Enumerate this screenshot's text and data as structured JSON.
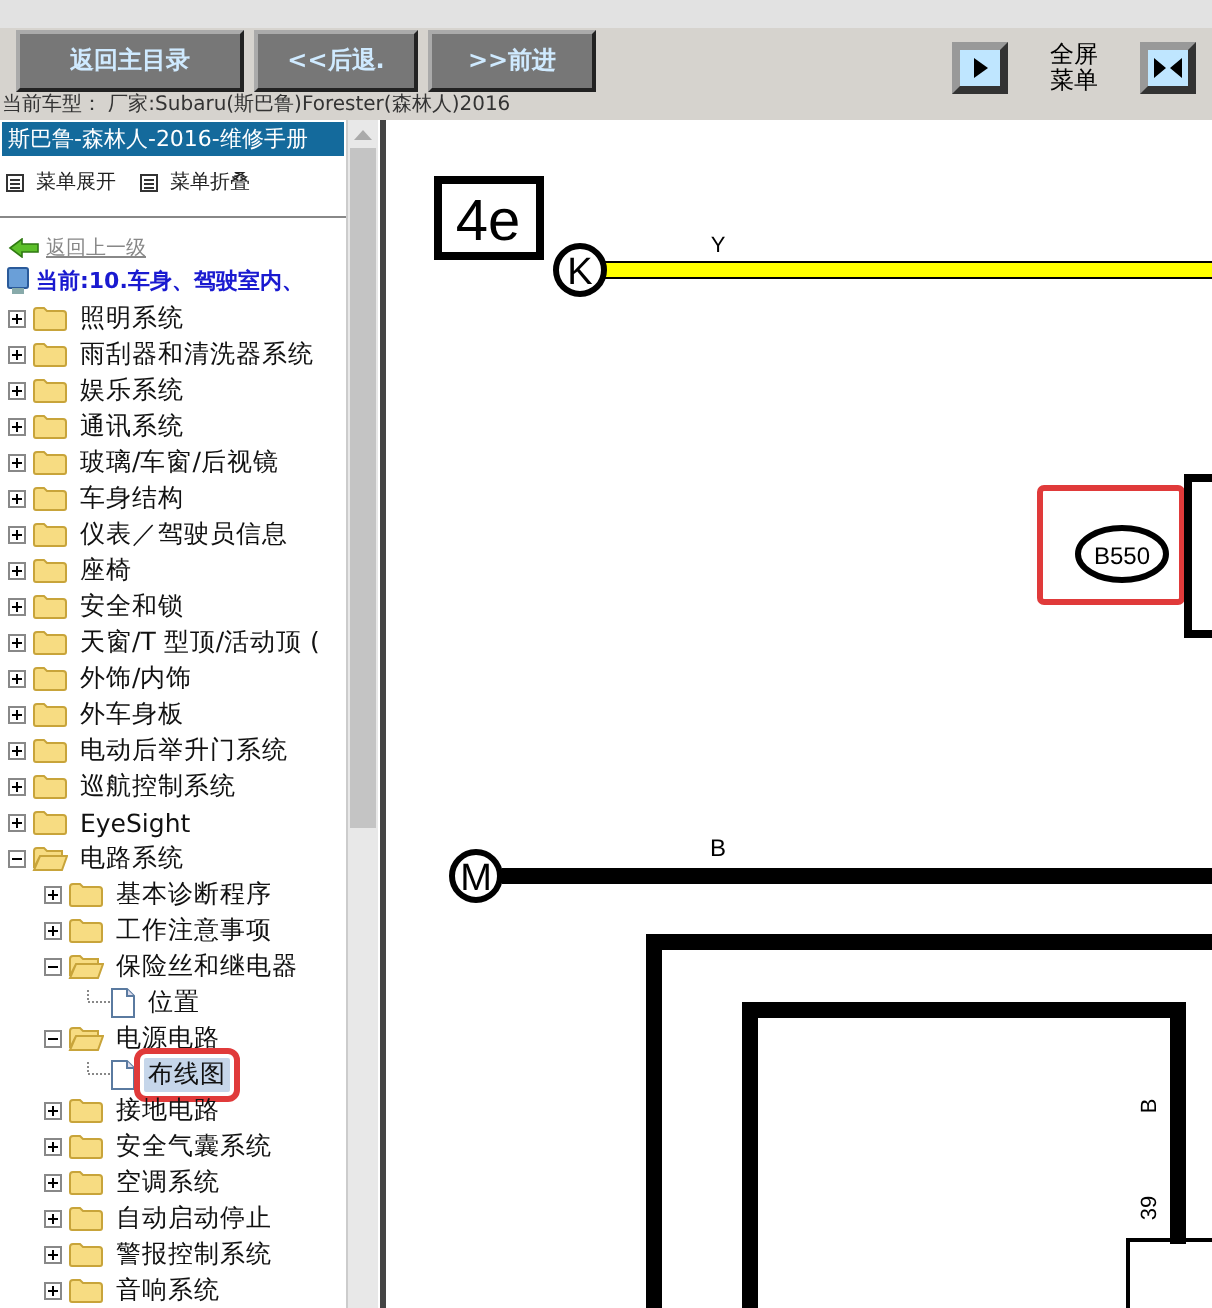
{
  "toolbar": {
    "buttons": [
      "返回主目录",
      "<<后退.",
      ">>前进"
    ],
    "fullscreen_label": "全屏菜单"
  },
  "vehicle_info": "当前车型：  厂家:Subaru(斯巴鲁)Forester(森林人)2016",
  "sidebar": {
    "title": "斯巴鲁-森林人-2016-维修手册",
    "expand_all": "菜单展开",
    "collapse_all": "菜单折叠",
    "back_link": "返回上一级",
    "current": "当前:10.车身、驾驶室内、",
    "tree": [
      {
        "label": "照明系统",
        "kind": "folder",
        "expanded": false,
        "selected": false
      },
      {
        "label": "雨刮器和清洗器系统",
        "kind": "folder",
        "expanded": false,
        "selected": false
      },
      {
        "label": "娱乐系统",
        "kind": "folder",
        "expanded": false,
        "selected": false
      },
      {
        "label": "通讯系统",
        "kind": "folder",
        "expanded": false,
        "selected": false
      },
      {
        "label": "玻璃/车窗/后视镜",
        "kind": "folder",
        "expanded": false,
        "selected": false
      },
      {
        "label": "车身结构",
        "kind": "folder",
        "expanded": false,
        "selected": false
      },
      {
        "label": "仪表／驾驶员信息",
        "kind": "folder",
        "expanded": false,
        "selected": false
      },
      {
        "label": "座椅",
        "kind": "folder",
        "expanded": false,
        "selected": false
      },
      {
        "label": "安全和锁",
        "kind": "folder",
        "expanded": false,
        "selected": false
      },
      {
        "label": "天窗/T 型顶/活动顶 (",
        "kind": "folder",
        "expanded": false,
        "selected": false
      },
      {
        "label": "外饰/内饰",
        "kind": "folder",
        "expanded": false,
        "selected": false
      },
      {
        "label": "外车身板",
        "kind": "folder",
        "expanded": false,
        "selected": false
      },
      {
        "label": "电动后举升门系统",
        "kind": "folder",
        "expanded": false,
        "selected": false
      },
      {
        "label": "巡航控制系统",
        "kind": "folder",
        "expanded": false,
        "selected": false
      },
      {
        "label": "EyeSight",
        "kind": "folder",
        "expanded": false,
        "selected": false
      },
      {
        "label": "电路系统",
        "kind": "folder",
        "expanded": true,
        "selected": false,
        "children": [
          {
            "label": "基本诊断程序",
            "kind": "folder",
            "expanded": false,
            "selected": false
          },
          {
            "label": "工作注意事项",
            "kind": "folder",
            "expanded": false,
            "selected": false
          },
          {
            "label": "保险丝和继电器",
            "kind": "folder",
            "expanded": true,
            "selected": false,
            "children": [
              {
                "label": "位置",
                "kind": "page",
                "selected": false
              }
            ]
          },
          {
            "label": "电源电路",
            "kind": "folder",
            "expanded": true,
            "selected": false,
            "children": [
              {
                "label": "布线图",
                "kind": "page",
                "selected": true
              }
            ]
          },
          {
            "label": "接地电路",
            "kind": "folder",
            "expanded": false,
            "selected": false
          },
          {
            "label": "安全气囊系统",
            "kind": "folder",
            "expanded": false,
            "selected": false
          },
          {
            "label": "空调系统",
            "kind": "folder",
            "expanded": false,
            "selected": false
          },
          {
            "label": "自动启动停止",
            "kind": "folder",
            "expanded": false,
            "selected": false
          },
          {
            "label": "警报控制系统",
            "kind": "folder",
            "expanded": false,
            "selected": false
          },
          {
            "label": "音响系统",
            "kind": "folder",
            "expanded": false,
            "selected": false
          }
        ]
      }
    ]
  },
  "diagram": {
    "page_code": "4e",
    "wire_labels": [
      "Y",
      "B"
    ],
    "connector_k": "K",
    "connector_m": "M",
    "connector_b550": "B550",
    "pin_wire": "B",
    "pin_number": "39"
  }
}
